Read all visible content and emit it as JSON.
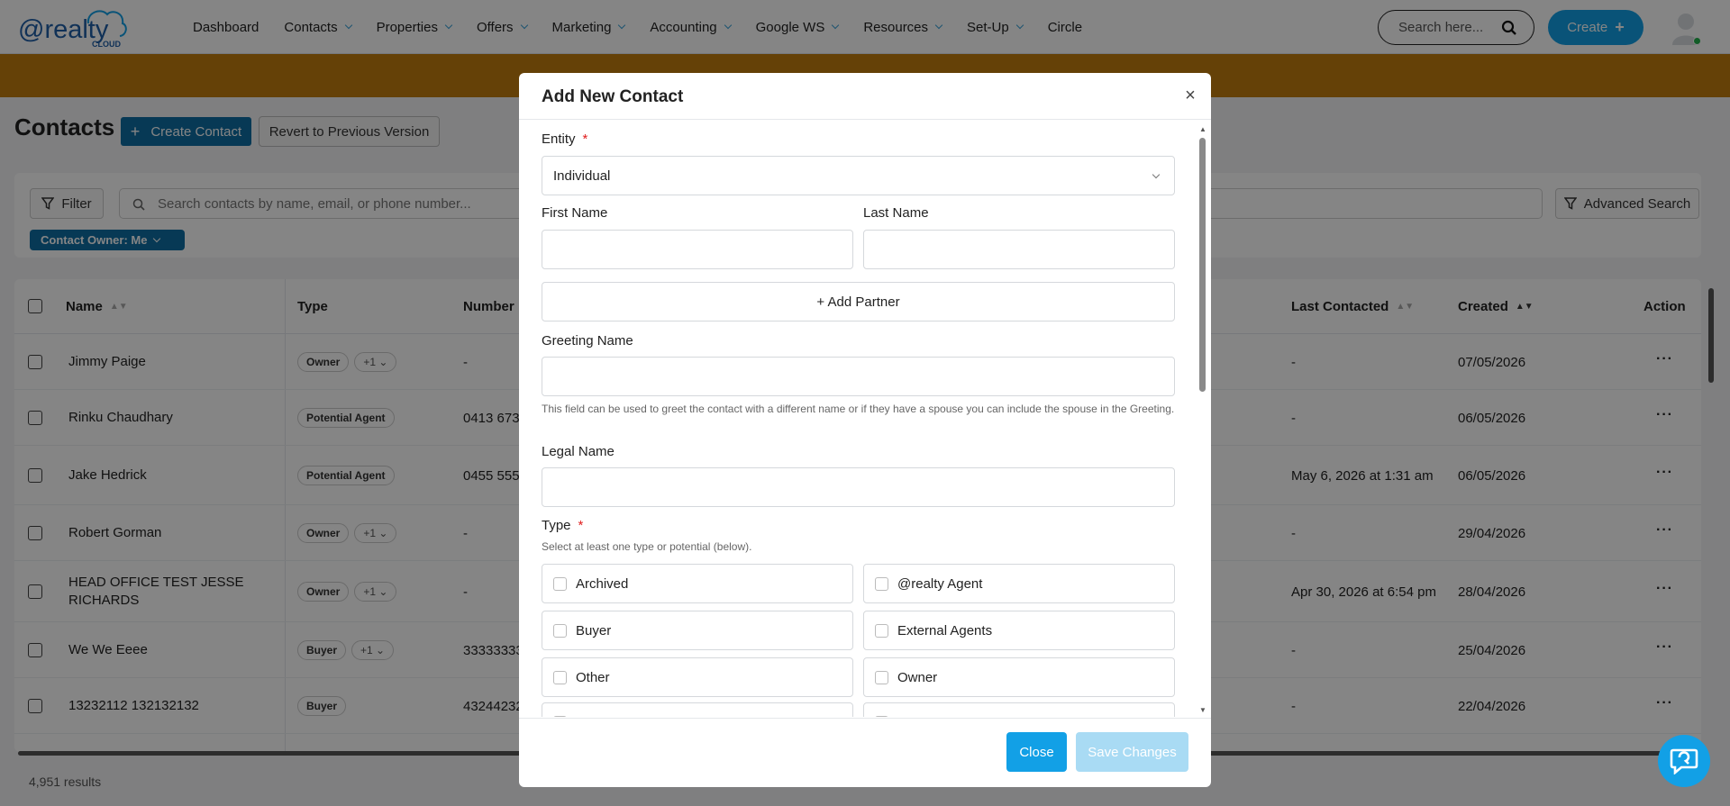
{
  "nav": {
    "logo_main": "@realty",
    "logo_sub": "CLOUD",
    "menu": [
      {
        "label": "Dashboard",
        "dropdown": false
      },
      {
        "label": "Contacts",
        "dropdown": true
      },
      {
        "label": "Properties",
        "dropdown": true
      },
      {
        "label": "Offers",
        "dropdown": true
      },
      {
        "label": "Marketing",
        "dropdown": true
      },
      {
        "label": "Accounting",
        "dropdown": true
      },
      {
        "label": "Google WS",
        "dropdown": true
      },
      {
        "label": "Resources",
        "dropdown": true
      },
      {
        "label": "Set-Up",
        "dropdown": true
      },
      {
        "label": "Circle",
        "dropdown": false
      }
    ],
    "search_placeholder": "Search here...",
    "create_label": "Create"
  },
  "page": {
    "title": "Contacts",
    "create_contact_label": "Create Contact",
    "revert_label": "Revert to Previous Version",
    "filter_label": "Filter",
    "search_placeholder": "Search contacts by name, email, or phone number...",
    "advanced_search_label": "Advanced Search",
    "chip_label": "Contact Owner: Me",
    "results": "4,951 results"
  },
  "table": {
    "columns": {
      "name": "Name",
      "type": "Type",
      "number": "Number",
      "last_contacted": "Last Contacted",
      "created": "Created",
      "action": "Action"
    },
    "rows": [
      {
        "name": "Jimmy Paige",
        "name2": "",
        "type": "Owner",
        "more": "+1",
        "number": "-",
        "last": "-",
        "created": "07/05/2026"
      },
      {
        "name": "Rinku Chaudhary",
        "name2": "",
        "type": "Potential Agent",
        "more": "",
        "number": "0413 673",
        "last": "-",
        "created": "06/05/2026"
      },
      {
        "name": "Jake Hedrick",
        "name2": "",
        "type": "Potential Agent",
        "more": "",
        "number": "0455 555",
        "last": "May 6, 2026 at 1:31 am",
        "created": "06/05/2026"
      },
      {
        "name": "Robert Gorman",
        "name2": "",
        "type": "Owner",
        "more": "+1",
        "number": "-",
        "last": "-",
        "created": "29/04/2026"
      },
      {
        "name": "HEAD OFFICE TEST JESSE",
        "name2": "RICHARDS",
        "type": "Owner",
        "more": "+1",
        "number": "-",
        "last": "Apr 30, 2026 at 6:54 pm",
        "created": "28/04/2026"
      },
      {
        "name": "We We Eeee",
        "name2": "",
        "type": "Buyer",
        "more": "+1",
        "number": "33333333",
        "last": "-",
        "created": "25/04/2026"
      },
      {
        "name": "13232112 132132132",
        "name2": "",
        "type": "Buyer",
        "more": "",
        "number": "43244232",
        "last": "-",
        "created": "22/04/2026"
      }
    ]
  },
  "modal": {
    "title": "Add New Contact",
    "entity_label": "Entity",
    "entity_value": "Individual",
    "first_name_label": "First Name",
    "last_name_label": "Last Name",
    "add_partner_label": "+ Add Partner",
    "greeting_label": "Greeting Name",
    "greeting_hint": "This field can be used to greet the contact with a different name or if they have a spouse you can include the spouse in the Greeting.",
    "legal_label": "Legal Name",
    "type_label": "Type",
    "type_hint": "Select at least one type or potential (below).",
    "type_options": [
      "Archived",
      "@realty Agent",
      "Buyer",
      "External Agents",
      "Other",
      "Owner"
    ],
    "close_label": "Close",
    "save_label": "Save Changes"
  },
  "colors": {
    "primary": "#12a0e6",
    "dark_primary": "#0f6ea3",
    "banner": "#c27d0f",
    "required": "#e01e1e"
  }
}
